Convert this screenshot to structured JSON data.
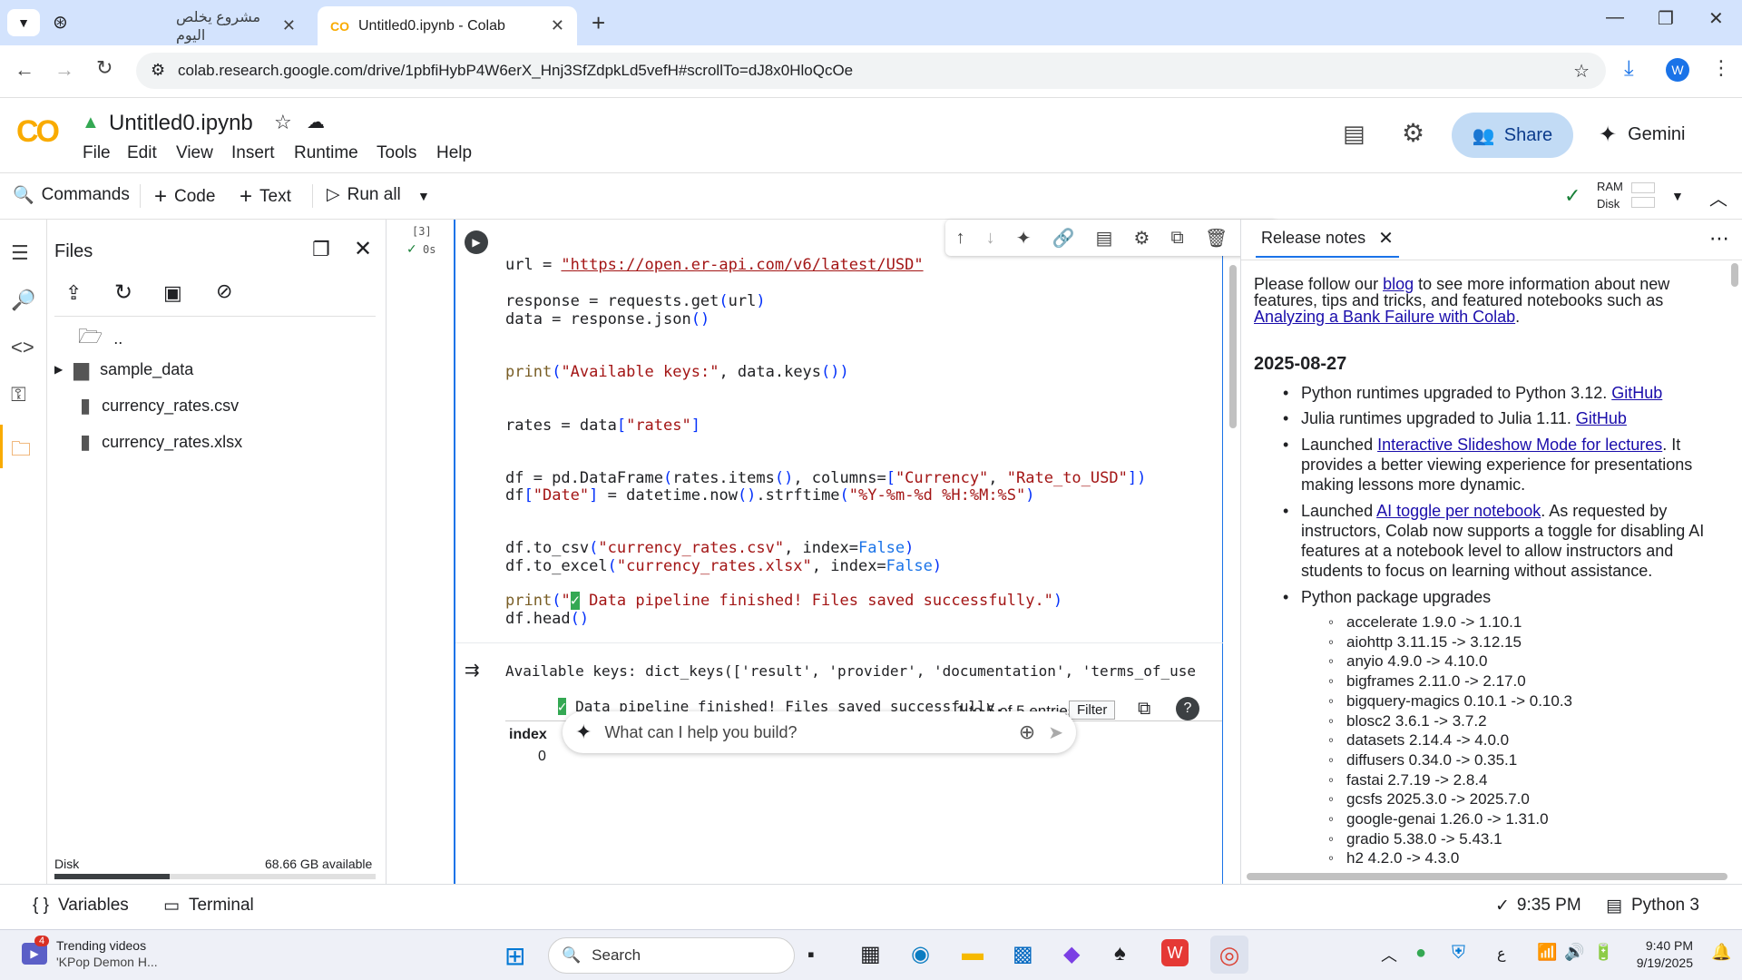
{
  "browser": {
    "tabs": [
      {
        "title": "مشروع يخلص اليوم",
        "active": false
      },
      {
        "title": "Untitled0.ipynb - Colab",
        "active": true
      }
    ],
    "url": "colab.research.google.com/drive/1pbfiHybP4W6erX_Hnj3SfZdpkLd5vefH#scrollTo=dJ8x0HloQcOe",
    "profile_initial": "W"
  },
  "colab": {
    "logo": "CO",
    "notebook_title": "Untitled0.ipynb",
    "menu": [
      "File",
      "Edit",
      "View",
      "Insert",
      "Runtime",
      "Tools",
      "Help"
    ],
    "share_label": "Share",
    "gemini_label": "Gemini",
    "toolbar": {
      "commands": "Commands",
      "code": "Code",
      "text": "Text",
      "run_all": "Run all",
      "ram": "RAM",
      "disk": "Disk"
    }
  },
  "files_panel": {
    "title": "Files",
    "items": [
      "..",
      "sample_data",
      "currency_rates.csv",
      "currency_rates.xlsx"
    ],
    "disk_label": "Disk",
    "disk_available": "68.66 GB available",
    "disk_used_fraction": 0.36
  },
  "cell": {
    "exec_count": "[3]",
    "exec_time": "0s",
    "output_line1": "Available keys: dict_keys(['result', 'provider', 'documentation', 'terms_of_use",
    "output_line2": " Data pipeline finished! Files saved successfully.",
    "table_info": "1 to 5 of 5 entries",
    "filter_label": "Filter",
    "table_header": "index",
    "table_row0": "0",
    "prompt_placeholder": "What can I help you build?"
  },
  "release_notes": {
    "tab_title": "Release notes",
    "intro_pre": "Please follow our ",
    "intro_link": "blog",
    "intro_mid": " to see more information about new features, tips and tricks, and featured notebooks such as ",
    "intro_link2": "Analyzing a Bank Failure with Colab",
    "intro_end": ".",
    "date": "2025-08-27",
    "items": [
      {
        "text": "Python runtimes upgraded to Python 3.12. ",
        "link": "GitHub",
        "after": ""
      },
      {
        "text": "Julia runtimes upgraded to Julia 1.11. ",
        "link": "GitHub",
        "after": ""
      },
      {
        "text": "Launched ",
        "link": "Interactive Slideshow Mode for lectures",
        "after": ". It provides a better viewing experience for presentations making lessons more dynamic."
      },
      {
        "text": "Launched ",
        "link": "AI toggle per notebook",
        "after": ". As requested by instructors, Colab now supports a toggle for disabling AI features at a notebook level to allow instructors and students to focus on learning without assistance."
      },
      {
        "text": "Python package upgrades",
        "link": "",
        "after": ""
      }
    ],
    "packages": [
      "accelerate 1.9.0 -> 1.10.1",
      "aiohttp 3.11.15 -> 3.12.15",
      "anyio 4.9.0 -> 4.10.0",
      "bigframes 2.11.0 -> 2.17.0",
      "bigquery-magics 0.10.1 -> 0.10.3",
      "blosc2 3.6.1 -> 3.7.2",
      "datasets 2.14.4 -> 4.0.0",
      "diffusers 0.34.0 -> 0.35.1",
      "fastai 2.7.19 -> 2.8.4",
      "gcsfs 2025.3.0 -> 2025.7.0",
      "google-genai 1.26.0 -> 1.31.0",
      "gradio 5.38.0 -> 5.43.1",
      "h2 4.2.0 -> 4.3.0"
    ]
  },
  "status_bar": {
    "variables": "Variables",
    "terminal": "Terminal",
    "time": "9:35 PM",
    "runtime": "Python 3"
  },
  "taskbar": {
    "widget_badge": "4",
    "widget_title": "Trending videos",
    "widget_sub": "'KPop Demon H...",
    "search": "Search",
    "lang": "ع",
    "clock_time": "9:40 PM",
    "clock_date": "9/19/2025"
  },
  "colors": {
    "accent": "#1a73e8",
    "colab_orange": "#f9ab00",
    "share_bg": "#c2dbf5",
    "link": "#1a0dab"
  }
}
